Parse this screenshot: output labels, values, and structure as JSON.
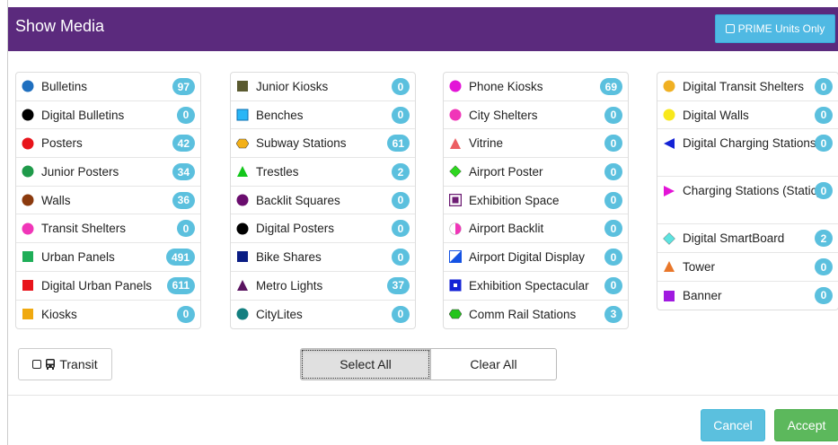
{
  "header": {
    "title": "Show Media",
    "prime_label": "PRIME Units Only",
    "accent": "#5b2a7d"
  },
  "columns": [
    {
      "items": [
        {
          "label": "Bulletins",
          "count": "97",
          "icon": "circle",
          "color": "#1f6fbf"
        },
        {
          "label": "Digital Bulletins",
          "count": "0",
          "icon": "circle",
          "color": "#000000"
        },
        {
          "label": "Posters",
          "count": "42",
          "icon": "circle",
          "color": "#e8141b"
        },
        {
          "label": "Junior Posters",
          "count": "34",
          "icon": "circle",
          "color": "#1f9a4a"
        },
        {
          "label": "Walls",
          "count": "36",
          "icon": "circle",
          "color": "#8b3a0e"
        },
        {
          "label": "Transit Shelters",
          "count": "0",
          "icon": "circle",
          "color": "#f036b8"
        },
        {
          "label": "Urban Panels",
          "count": "491",
          "icon": "square",
          "color": "#1fae58"
        },
        {
          "label": "Digital Urban Panels",
          "count": "611",
          "icon": "square",
          "color": "#e8141b"
        },
        {
          "label": "Kiosks",
          "count": "0",
          "icon": "square",
          "color": "#f0a90f"
        }
      ]
    },
    {
      "items": [
        {
          "label": "Junior Kiosks",
          "count": "0",
          "icon": "square",
          "color": "#5a5a30"
        },
        {
          "label": "Benches",
          "count": "0",
          "icon": "square-border",
          "color": "#29b6f6"
        },
        {
          "label": "Subway Stations",
          "count": "61",
          "icon": "hexagon",
          "color": "#f3b017"
        },
        {
          "label": "Trestles",
          "count": "2",
          "icon": "triangle",
          "color": "#13c61b"
        },
        {
          "label": "Backlit Squares",
          "count": "0",
          "icon": "circle",
          "color": "#6a0d6e"
        },
        {
          "label": "Digital Posters",
          "count": "0",
          "icon": "circle",
          "color": "#000000"
        },
        {
          "label": "Bike Shares",
          "count": "0",
          "icon": "square",
          "color": "#0a1d84"
        },
        {
          "label": "Metro Lights",
          "count": "37",
          "icon": "triangle",
          "color": "#5a1460"
        },
        {
          "label": "CityLites",
          "count": "0",
          "icon": "circle",
          "color": "#137f80"
        }
      ]
    },
    {
      "items": [
        {
          "label": "Phone Kiosks",
          "count": "69",
          "icon": "circle",
          "color": "#e314d7"
        },
        {
          "label": "City Shelters",
          "count": "0",
          "icon": "circle",
          "color": "#f036b8"
        },
        {
          "label": "Vitrine",
          "count": "0",
          "icon": "triangle",
          "color": "#ec5e63"
        },
        {
          "label": "Airport Poster",
          "count": "0",
          "icon": "diamond",
          "color": "#2ed620"
        },
        {
          "label": "Exhibition Space",
          "count": "0",
          "icon": "framed-square",
          "color": "#6d1c73"
        },
        {
          "label": "Airport Backlit",
          "count": "0",
          "icon": "half-circle",
          "color": "#f036b8"
        },
        {
          "label": "Airport Digital Display",
          "count": "0",
          "icon": "diagonal-square",
          "color": "#1452e3"
        },
        {
          "label": "Exhibition Spectacular",
          "count": "0",
          "icon": "dot-square",
          "color": "#1423d6"
        },
        {
          "label": "Comm Rail Stations",
          "count": "3",
          "icon": "hexagon",
          "color": "#23c41b"
        }
      ]
    },
    {
      "items": [
        {
          "label": "Digital Transit Shelters",
          "count": "0",
          "icon": "circle",
          "color": "#f0b022"
        },
        {
          "label": "Digital Walls",
          "count": "0",
          "icon": "circle",
          "color": "#f8e81c"
        },
        {
          "label": "Digital Charging Stations",
          "count": "0",
          "icon": "triangle-left",
          "color": "#1423d6",
          "tall": true
        },
        {
          "label": "Charging Stations (Static)",
          "count": "0",
          "icon": "triangle-right",
          "color": "#e314d7",
          "tall": true
        },
        {
          "label": "Digital SmartBoard",
          "count": "2",
          "icon": "diamond",
          "color": "#5ee3e0"
        },
        {
          "label": "Tower",
          "count": "0",
          "icon": "triangle",
          "color": "#e9772a"
        },
        {
          "label": "Banner",
          "count": "0",
          "icon": "square",
          "color": "#a01ae0"
        }
      ]
    }
  ],
  "controls": {
    "transit_label": "Transit",
    "select_all_label": "Select All",
    "clear_all_label": "Clear All"
  },
  "footer": {
    "cancel_label": "Cancel",
    "accept_label": "Accept"
  }
}
